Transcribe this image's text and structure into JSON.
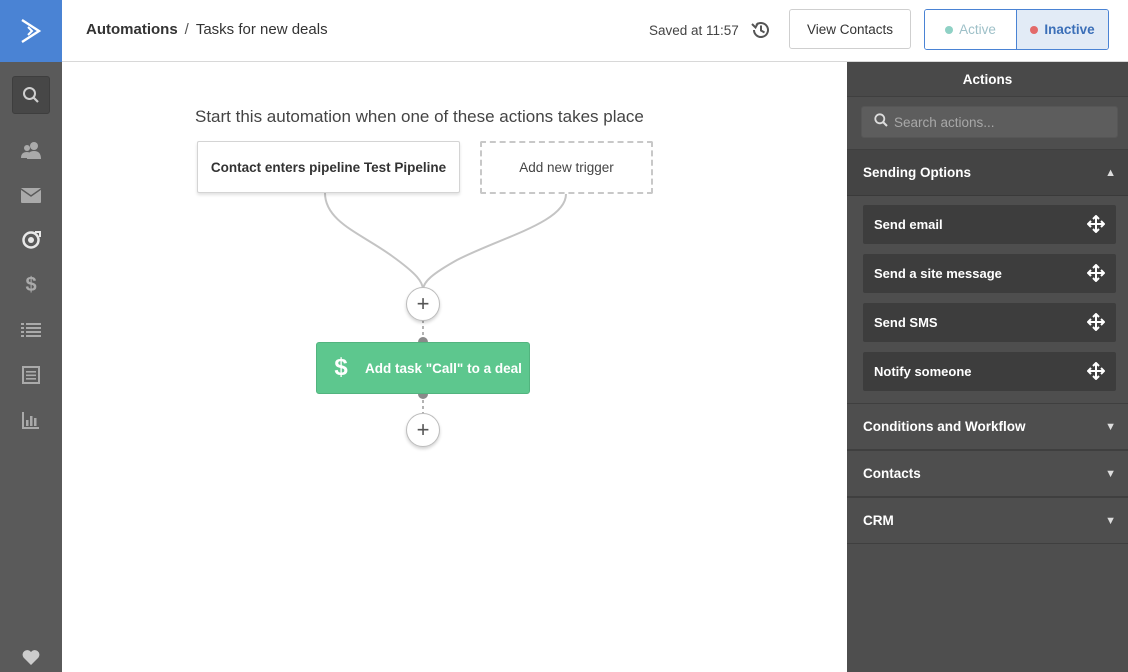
{
  "nav": {
    "icons": [
      "logo-icon",
      "search-icon",
      "contacts-icon",
      "email-icon",
      "automations-icon",
      "deals-icon",
      "lists-icon",
      "forms-icon",
      "reports-icon",
      "favorites-icon"
    ]
  },
  "header": {
    "breadcrumb_root": "Automations",
    "breadcrumb_sep": "/",
    "breadcrumb_current": "Tasks for new deals",
    "saved_text": "Saved at 11:57",
    "view_contacts_label": "View Contacts",
    "status_active_label": "Active",
    "status_inactive_label": "Inactive",
    "status_selected": "Inactive"
  },
  "canvas": {
    "title": "Start this automation when one of these actions takes place",
    "trigger_label": "Contact enters pipeline Test Pipeline",
    "add_trigger_label": "Add new trigger",
    "plus_label": "+",
    "action_icon": "$",
    "action_label": "Add task \"Call\" to a deal"
  },
  "panel": {
    "title": "Actions",
    "search_placeholder": "Search actions...",
    "sections": [
      {
        "label": "Sending Options",
        "expanded": true,
        "items": [
          "Send email",
          "Send a site message",
          "Send SMS",
          "Notify someone"
        ]
      },
      {
        "label": "Conditions and Workflow",
        "expanded": false
      },
      {
        "label": "Contacts",
        "expanded": false
      },
      {
        "label": "CRM",
        "expanded": false
      }
    ]
  },
  "colors": {
    "brand": "#4a83d4",
    "nav_bg": "#5a5a5a",
    "panel_bg": "#4e4e4e",
    "action_green": "#5dc78e",
    "active_dot": "#8fd1c5",
    "inactive_dot": "#e36a6a"
  }
}
